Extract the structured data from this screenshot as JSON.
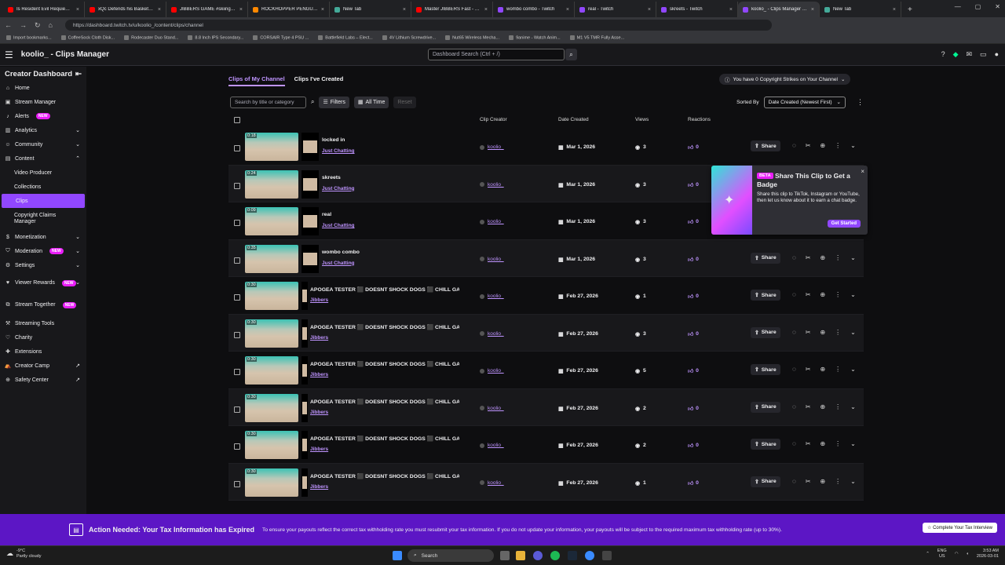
{
  "browser": {
    "tabs": [
      {
        "title": "Is Resident Evil Requiem Go",
        "color": "#ff0000"
      },
      {
        "title": "xQc Defends his Basketball",
        "color": "#ff0000"
      },
      {
        "title": "JIBBERS GAME #skiing #bigs",
        "color": "#ff0000"
      },
      {
        "title": "ROCKHOPPER PENGUIN at ti",
        "color": "#ff8800"
      },
      {
        "title": "New Tab",
        "color": "#4a9"
      },
      {
        "title": "Master JIBBERS Fast - YouTu",
        "color": "#ff0000"
      },
      {
        "title": "wombo combo - Twitch",
        "color": "#9147ff"
      },
      {
        "title": "real - Twitch",
        "color": "#9147ff"
      },
      {
        "title": "skreets - Twitch",
        "color": "#9147ff"
      },
      {
        "title": "koolio_ - Clips Manager - Tw",
        "color": "#9147ff",
        "active": true
      },
      {
        "title": "New Tab",
        "color": "#4a9"
      }
    ],
    "url": "https://dashboard.twitch.tv/u/koolio_/content/clips/channel",
    "bookmarks": [
      "Import bookmarks...",
      "CoffeeSock Cloth Disk...",
      "Rodecaster Duo Stand...",
      "8.8 Inch IPS Secondary...",
      "CORSAIR Type 4 PSU ...",
      "Battlefield Labs – Elect...",
      "4V Lithium Screwdrive...",
      "Nut65 Wireless Mecha...",
      "9anime - Watch Anim...",
      "M1 V5 TMR Fully Asse..."
    ]
  },
  "header": {
    "title": "koolio_ - Clips Manager",
    "search_placeholder": "Dashboard Search (Ctrl + /)"
  },
  "sidebar": {
    "title": "Creator Dashboard",
    "items": [
      {
        "label": "Home",
        "icon": "home-icon",
        "glyph": "⌂"
      },
      {
        "label": "Stream Manager",
        "icon": "stream-icon",
        "glyph": "▣"
      },
      {
        "label": "Alerts",
        "icon": "alerts-icon",
        "glyph": "♪",
        "badge": "NEW"
      },
      {
        "label": "Analytics",
        "icon": "analytics-icon",
        "glyph": "▥",
        "chev": "⌄"
      },
      {
        "label": "Community",
        "icon": "community-icon",
        "glyph": "☺",
        "chev": "⌄"
      },
      {
        "label": "Content",
        "icon": "content-icon",
        "glyph": "▤",
        "chev": "⌃"
      },
      {
        "label": "Video Producer",
        "sub": true
      },
      {
        "label": "Collections",
        "sub": true
      },
      {
        "label": "Clips",
        "sub": true,
        "active": true
      },
      {
        "label": "Copyright Claims Manager",
        "sub": true,
        "two": true
      },
      {
        "label": "Monetization",
        "icon": "money-icon",
        "glyph": "$",
        "chev": "⌄"
      },
      {
        "label": "Moderation",
        "icon": "shield-icon",
        "glyph": "⛉",
        "badge": "NEW",
        "chev": "⌄"
      },
      {
        "label": "Settings",
        "icon": "gear-icon",
        "glyph": "⚙",
        "chev": "⌄"
      },
      {
        "label": "Viewer Rewards",
        "icon": "rewards-icon",
        "glyph": "♥",
        "badge": "NEW",
        "chev": "⌄",
        "two": true
      },
      {
        "label": "Stream Together",
        "icon": "together-icon",
        "glyph": "⧉",
        "badge": "NEW",
        "two": true
      },
      {
        "label": "Streaming Tools",
        "icon": "tools-icon",
        "glyph": "⚒"
      },
      {
        "label": "Charity",
        "icon": "charity-icon",
        "glyph": "♡"
      },
      {
        "label": "Extensions",
        "icon": "extensions-icon",
        "glyph": "✚"
      },
      {
        "label": "Creator Camp",
        "icon": "camp-icon",
        "glyph": "⛺",
        "ext": "↗"
      },
      {
        "label": "Safety Center",
        "icon": "safety-icon",
        "glyph": "⊕",
        "ext": "↗"
      }
    ]
  },
  "main": {
    "tab_mine": "Clips of My Channel",
    "tab_created": "Clips I've Created",
    "strikes": "You have 0 Copyright Strikes on Your Channel",
    "search_placeholder": "Search by title or category",
    "filters": "Filters",
    "all_time": "All Time",
    "reset": "Reset",
    "sorted_by": "Sorted By",
    "sort_value": "Date Created (Newest First)",
    "columns": {
      "creator": "Clip Creator",
      "date": "Date Created",
      "views": "Views",
      "reactions": "Reactions"
    },
    "share_label": "Share",
    "clips": [
      {
        "duration": "0:18",
        "title": "locked in",
        "category": "Just Chatting",
        "creator": "koolio_",
        "date": "Mar 1, 2026",
        "views": "3",
        "reactions": "0",
        "thumb2": true
      },
      {
        "duration": "0:24",
        "title": "skreets",
        "category": "Just Chatting",
        "creator": "koolio_",
        "date": "Mar 1, 2026",
        "views": "3",
        "reactions": "0",
        "thumb2": true
      },
      {
        "duration": "0:09",
        "title": "real",
        "category": "Just Chatting",
        "creator": "koolio_",
        "date": "Mar 1, 2026",
        "views": "3",
        "reactions": "0",
        "thumb2": true
      },
      {
        "duration": "0:35",
        "title": "wombo combo",
        "category": "Just Chatting",
        "creator": "koolio_",
        "date": "Mar 1, 2026",
        "views": "3",
        "reactions": "0",
        "thumb2": true
      },
      {
        "duration": "0:30",
        "title": "APOGEA TESTER ⬛ DOESNT SHOCK DOGS ⬛ CHILL GA...",
        "category": "Jibbers",
        "creator": "koolio_",
        "date": "Feb 27, 2026",
        "views": "1",
        "reactions": "0",
        "thumb2": false
      },
      {
        "duration": "0:30",
        "title": "APOGEA TESTER ⬛ DOESNT SHOCK DOGS ⬛ CHILL GA...",
        "category": "Jibbers",
        "creator": "koolio_",
        "date": "Feb 27, 2026",
        "views": "3",
        "reactions": "0",
        "thumb2": false
      },
      {
        "duration": "0:30",
        "title": "APOGEA TESTER ⬛ DOESNT SHOCK DOGS ⬛ CHILL GA...",
        "category": "Jibbers",
        "creator": "koolio_",
        "date": "Feb 27, 2026",
        "views": "5",
        "reactions": "0",
        "thumb2": false
      },
      {
        "duration": "0:30",
        "title": "APOGEA TESTER ⬛ DOESNT SHOCK DOGS ⬛ CHILL GA...",
        "category": "Jibbers",
        "creator": "koolio_",
        "date": "Feb 27, 2026",
        "views": "2",
        "reactions": "0",
        "thumb2": false
      },
      {
        "duration": "0:30",
        "title": "APOGEA TESTER ⬛ DOESNT SHOCK DOGS ⬛ CHILL GA...",
        "category": "Jibbers",
        "creator": "koolio_",
        "date": "Feb 27, 2026",
        "views": "2",
        "reactions": "0",
        "thumb2": false
      },
      {
        "duration": "0:30",
        "title": "APOGEA TESTER ⬛ DOESNT SHOCK DOGS ⬛ CHILL GA...",
        "category": "Jibbers",
        "creator": "koolio_",
        "date": "Feb 27, 2026",
        "views": "1",
        "reactions": "0",
        "thumb2": false
      }
    ]
  },
  "popup": {
    "badge": "BETA",
    "title": "Share This Clip to Get a Badge",
    "body": "Share this clip to TikTok, Instagram or YouTube, then let us know about it to earn a chat badge.",
    "button": "Get Started"
  },
  "tax_banner": {
    "title": "Action Needed: Your Tax Information has Expired",
    "body": "To ensure your payouts reflect the correct tax withholding rate you must resubmit your tax information. If you do not update your information, your payouts will be subject to the required maximum tax withholding rate (up to 30%).",
    "button": "Complete Your Tax Interview"
  },
  "taskbar": {
    "temp": "-9°C",
    "weather": "Partly cloudy",
    "search": "Search",
    "lang": "ENG",
    "region": "US",
    "time": "3:53 AM",
    "date": "2026-03-01"
  },
  "colors": {
    "accent": "#9147ff",
    "link": "#bf94ff",
    "banner": "#5c16c5"
  }
}
